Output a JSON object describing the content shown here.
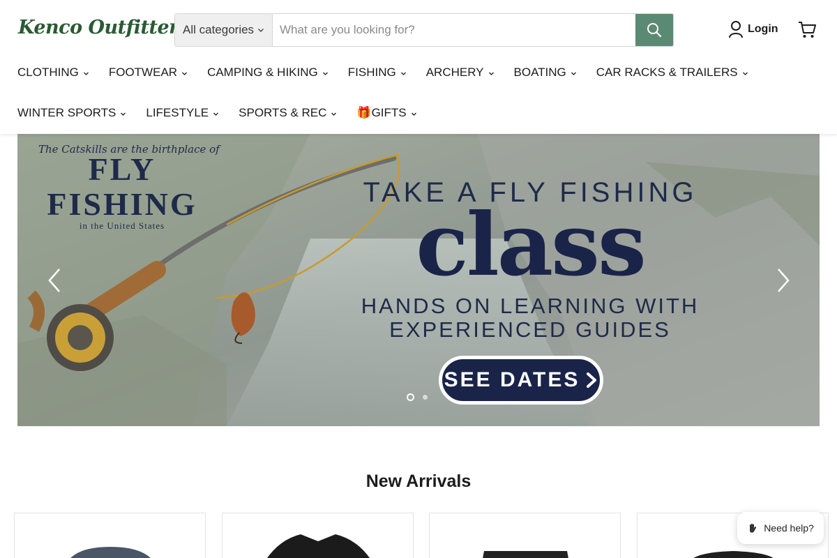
{
  "brand": {
    "logo_text": "Kenco Outfitters",
    "registered_mark": "®",
    "color": "#2a5a34"
  },
  "search": {
    "category_label": "All categories",
    "placeholder": "What are you looking for?",
    "button_icon": "search-icon",
    "button_color": "#5b8a73"
  },
  "account": {
    "login_label": "Login",
    "login_icon": "user-icon",
    "cart_icon": "cart-icon"
  },
  "nav": {
    "row1": [
      "CLOTHING",
      "FOOTWEAR",
      "CAMPING & HIKING",
      "FISHING",
      "ARCHERY",
      "BOATING",
      "CAR RACKS & TRAILERS"
    ],
    "row2": [
      "WINTER SPORTS",
      "LIFESTYLE",
      "SPORTS & REC",
      "🎁GIFTS"
    ]
  },
  "banner": {
    "script_line": "The Catskills are the birthplace of",
    "fly": "FLY",
    "fishing": "FISHING",
    "us_line": "in the United States",
    "headline": "TAKE A FLY FISHING",
    "class_word": "class",
    "sub_line1": "HANDS ON LEARNING WITH",
    "sub_line2": "EXPERIENCED GUIDES",
    "cta": "SEE DATES",
    "accent_color": "#1a2449"
  },
  "section": {
    "title": "New Arrivals"
  },
  "help": {
    "label": "Need help?",
    "icon": "hand-wave-icon"
  }
}
